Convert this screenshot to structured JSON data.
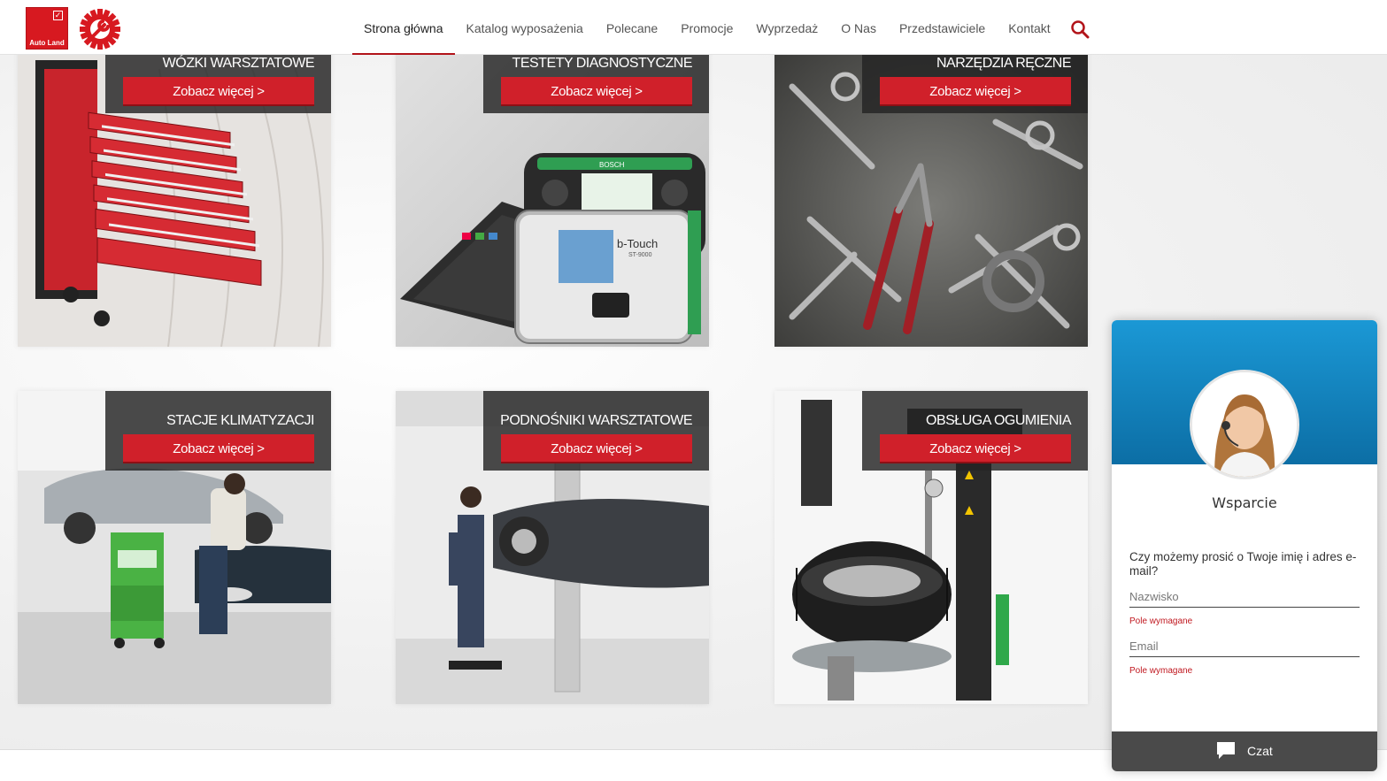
{
  "header": {
    "logo_text": "Auto Land",
    "nav": [
      {
        "label": "Strona główna",
        "active": true
      },
      {
        "label": "Katalog wyposażenia",
        "active": false
      },
      {
        "label": "Polecane",
        "active": false
      },
      {
        "label": "Promocje",
        "active": false
      },
      {
        "label": "Wyprzedaż",
        "active": false
      },
      {
        "label": "O Nas",
        "active": false
      },
      {
        "label": "Przedstawiciele",
        "active": false
      },
      {
        "label": "Kontakt",
        "active": false
      }
    ],
    "search_icon": "search-icon"
  },
  "tiles": [
    {
      "title": "WÓZKI WARSZTATOWE",
      "button": "Zobacz więcej >"
    },
    {
      "title": "TESTETY DIAGNOSTYCZNE",
      "button": "Zobacz więcej >"
    },
    {
      "title": "NARZĘDZIA RĘCZNE",
      "button": "Zobacz więcej >"
    },
    {
      "title": "STACJE KLIMATYZACJI",
      "button": "Zobacz więcej >"
    },
    {
      "title": "PODNOŚNIKI WARSZTATOWE",
      "button": "Zobacz więcej >"
    },
    {
      "title": "OBSŁUGA OGUMIENIA",
      "button": "Zobacz więcej >"
    }
  ],
  "device_labels": {
    "brand": "BOSCH",
    "product": "b-Touch",
    "model": "ST-9000"
  },
  "chat": {
    "name": "Wsparcie",
    "question": "Czy możemy prosić o Twoje imię i adres e-mail?",
    "name_placeholder": "Nazwisko",
    "email_placeholder": "Email",
    "required_1": "Pole wymagane",
    "required_2": "Pole wymagane",
    "button_label": "Czat"
  },
  "colors": {
    "brand_red": "#d0202a",
    "chat_blue": "#1b98d5",
    "chat_bar": "#4a4a4a"
  }
}
